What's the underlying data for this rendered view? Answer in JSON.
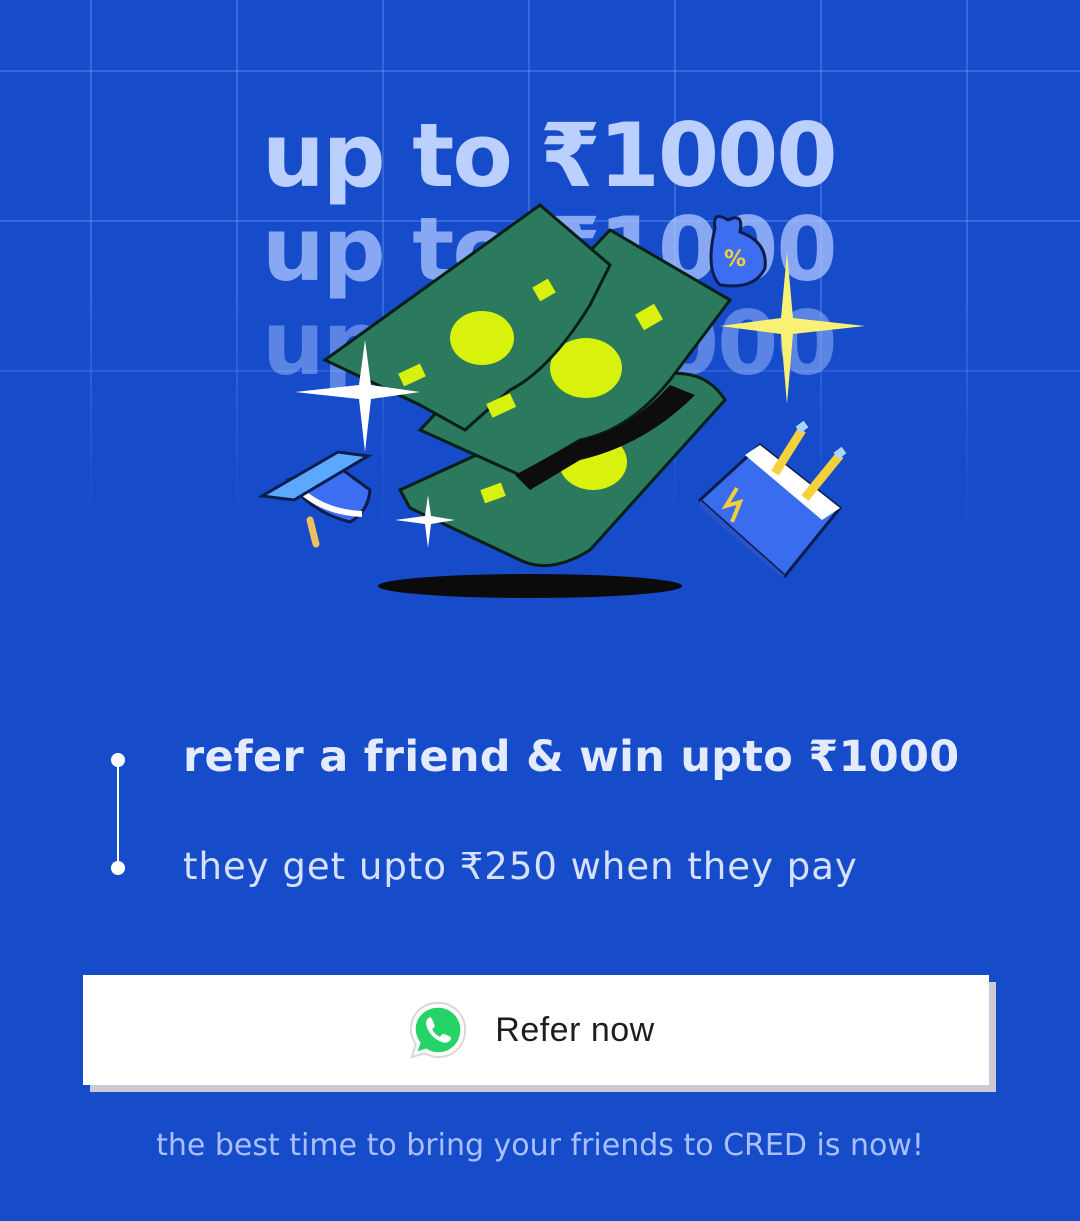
{
  "banner": {
    "headline_repeats": [
      "up to ₹1000",
      "up to ₹1000",
      "up to ₹1000"
    ]
  },
  "steps": [
    {
      "text": "refer a friend & win upto ₹1000"
    },
    {
      "text": "they get upto ₹250 when they pay"
    }
  ],
  "refer_button": {
    "label": "Refer now",
    "icon": "whatsapp-icon"
  },
  "footer": {
    "text": "the best time to bring your friends to CRED is now!"
  },
  "colors": {
    "background": "#164bca",
    "button_bg": "#ffffff",
    "cash_green": "#2b7a5e",
    "cash_accent": "#d8f20d",
    "whatsapp": "#25d366"
  },
  "illustration_icons": [
    "cash-stack-icon",
    "graduation-cap-icon",
    "percent-bag-icon",
    "power-plug-icon",
    "sparkle-icon"
  ]
}
